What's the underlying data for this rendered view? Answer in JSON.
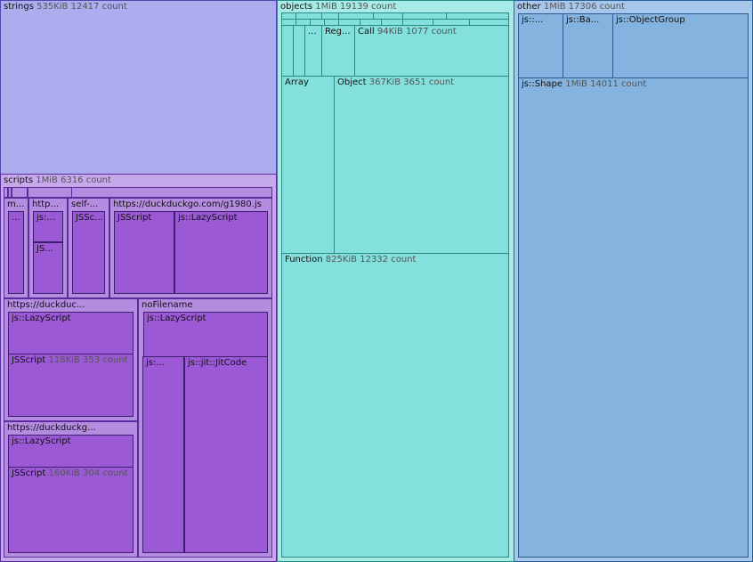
{
  "strings": {
    "name": "strings",
    "size": "535KiB",
    "count": "12417 count"
  },
  "scripts": {
    "name": "scripts",
    "size": "1MiB",
    "count": "6316 count",
    "m_label": "m...",
    "m_child": "...",
    "http_label": "http...",
    "http_child1": "js:...",
    "http_child2": "JS...",
    "self_label": "self-...",
    "self_child": "JSSc...",
    "g1980_label": "https://duckduckgo.com/g1980.js",
    "g1980_jsscript": "JSScript",
    "g1980_lazy": "js::LazyScript",
    "duckduc_label": "https://duckduc...",
    "duckduc_lazy": "js::LazyScript",
    "duckduc_jsscript": "JSScript",
    "duckduc_jsscript_size": "118KiB",
    "duckduc_jsscript_count": "353 count",
    "duckduckg_label": "https://duckduckg...",
    "duckduckg_lazy": "js::LazyScript",
    "duckduckg_jsscript": "JSScript",
    "duckduckg_jsscript_size": "160KiB",
    "duckduckg_jsscript_count": "304 count",
    "nofile_label": "noFilename",
    "nofile_lazy": "js::LazyScript",
    "nofile_js": "js:...",
    "nofile_jit": "js::jit::JitCode"
  },
  "objects": {
    "name": "objects",
    "size": "1MiB",
    "count": "19139 count",
    "dots": "...",
    "reg": "Reg...",
    "call_label": "Call",
    "call_size": "94KiB",
    "call_count": "1077 count",
    "array": "Array",
    "object_label": "Object",
    "object_size": "367KiB",
    "object_count": "3651 count",
    "function_label": "Function",
    "function_size": "825KiB",
    "function_count": "12332 count"
  },
  "other": {
    "name": "other",
    "size": "1MiB",
    "count": "17306 count",
    "child1": "js::...",
    "child2": "js::Ba...",
    "child3": "js::ObjectGroup",
    "shape_label": "js::Shape",
    "shape_size": "1MiB",
    "shape_count": "14011 count"
  },
  "colors": {
    "strings": "#acacee",
    "scripts": "#c6a9ea",
    "scripts_leaf": "#9b59d6",
    "objects": "#a8ebe6",
    "objects_leaf": "#84e0dc",
    "other": "#a7c6ec",
    "other_leaf": "#84b3e0"
  }
}
